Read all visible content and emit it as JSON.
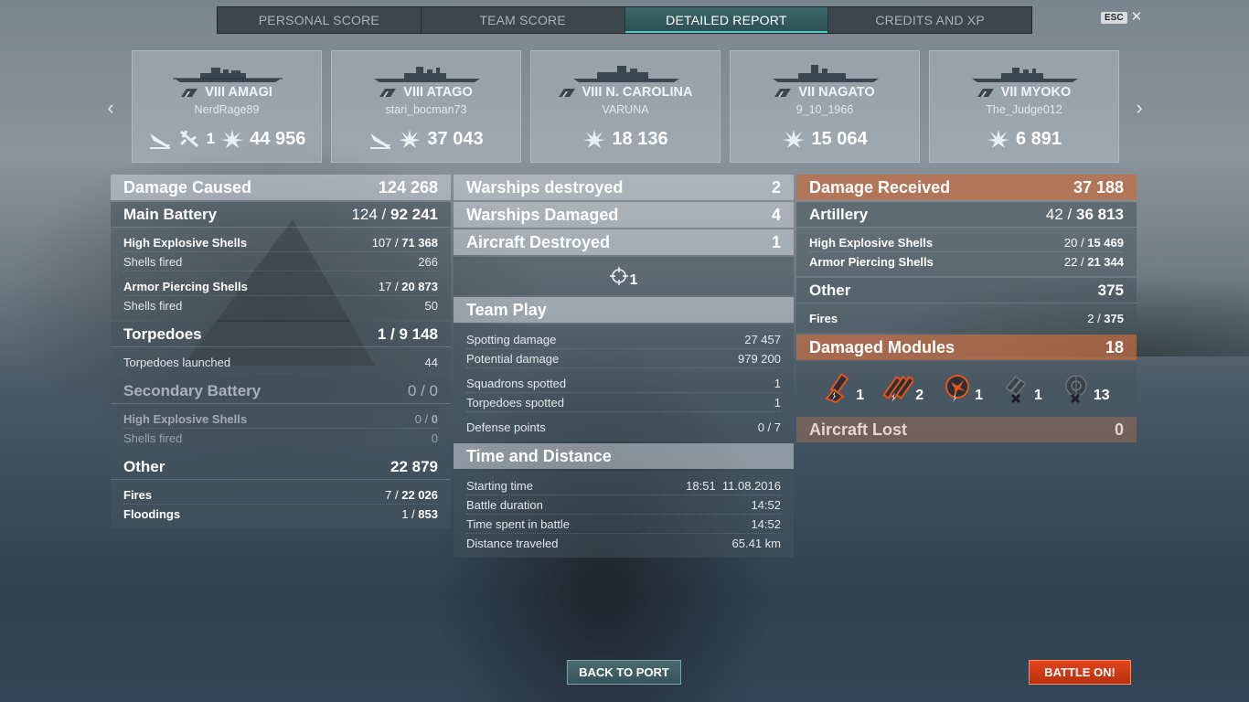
{
  "tabs": {
    "personal_score": "PERSONAL SCORE",
    "team_score": "TEAM SCORE",
    "detailed_report": "DETAILED REPORT",
    "credits_xp": "CREDITS AND XP"
  },
  "esc_label": "ESC",
  "ships": [
    {
      "tier_name": "VIII AMAGI",
      "player": "NerdRage89",
      "planes": "1",
      "damage": "44 956"
    },
    {
      "tier_name": "VIII ATAGO",
      "player": "stari_bocman73",
      "damage": "37 043"
    },
    {
      "tier_name": "VIII N. CAROLINA",
      "player": "VARUNA",
      "damage": "18 136"
    },
    {
      "tier_name": "VII NAGATO",
      "player": "9_10_1966",
      "damage": "15 064"
    },
    {
      "tier_name": "VII MYOKO",
      "player": "The_Judge012",
      "damage": "6 891"
    }
  ],
  "left": {
    "damage_caused": {
      "label": "Damage Caused",
      "value": "124 268"
    },
    "main_battery": {
      "label": "Main Battery",
      "hits": "124",
      "sep": " / ",
      "value": "92 241"
    },
    "he_shells": {
      "label": "High Explosive Shells",
      "hits": "107",
      "value": "71 368"
    },
    "he_fired": {
      "label": "Shells fired",
      "value": "266"
    },
    "ap_shells": {
      "label": "Armor Piercing Shells",
      "hits": "17",
      "value": "20 873"
    },
    "ap_fired": {
      "label": "Shells fired",
      "value": "50"
    },
    "torpedoes": {
      "label": "Torpedoes",
      "value": "1 / 9 148"
    },
    "torps_launched": {
      "label": "Torpedoes launched",
      "value": "44"
    },
    "secondary": {
      "label": "Secondary Battery",
      "value": "0 / 0"
    },
    "sec_he": {
      "label": "High Explosive Shells",
      "hits": "0",
      "value": "0"
    },
    "sec_fired": {
      "label": "Shells fired",
      "value": "0"
    },
    "other": {
      "label": "Other",
      "value": "22 879"
    },
    "fires": {
      "label": "Fires",
      "hits": "7",
      "value": "22 026"
    },
    "floodings": {
      "label": "Floodings",
      "hits": "1",
      "value": "853"
    }
  },
  "mid": {
    "warships_destroyed": {
      "label": "Warships destroyed",
      "value": "2"
    },
    "warships_damaged": {
      "label": "Warships Damaged",
      "value": "4"
    },
    "aircraft_destroyed": {
      "label": "Aircraft Destroyed",
      "value": "1"
    },
    "aircraft_icon_count": "1",
    "team_play": {
      "label": "Team Play"
    },
    "spotting_damage": {
      "label": "Spotting damage",
      "value": "27 457"
    },
    "potential_damage": {
      "label": "Potential damage",
      "value": "979 200"
    },
    "squadrons_spotted": {
      "label": "Squadrons spotted",
      "value": "1"
    },
    "torpedoes_spotted": {
      "label": "Torpedoes spotted",
      "value": "1"
    },
    "defense_points": {
      "label": "Defense points",
      "value": "0 / 7"
    },
    "time_distance": {
      "label": "Time and Distance"
    },
    "starting_time": {
      "label": "Starting time",
      "value": "18:51  11.08.2016"
    },
    "battle_duration": {
      "label": "Battle duration",
      "value": "14:52"
    },
    "time_spent": {
      "label": "Time spent in battle",
      "value": "14:52"
    },
    "distance": {
      "label": "Distance traveled",
      "value": "65.41 km"
    }
  },
  "right": {
    "damage_received": {
      "label": "Damage Received",
      "value": "37 188"
    },
    "artillery": {
      "label": "Artillery",
      "hits": "42",
      "value": "36 813"
    },
    "he_shells": {
      "label": "High Explosive Shells",
      "hits": "20",
      "value": "15 469"
    },
    "ap_shells": {
      "label": "Armor Piercing Shells",
      "hits": "22",
      "value": "21 344"
    },
    "other": {
      "label": "Other",
      "value": "375"
    },
    "fires": {
      "label": "Fires",
      "hits": "2",
      "value": "375"
    },
    "damaged_modules": {
      "label": "Damaged Modules",
      "value": "18"
    },
    "modules": [
      {
        "icon": "main-battery-module-icon",
        "count": "1"
      },
      {
        "icon": "torpedo-tubes-module-icon",
        "count": "2"
      },
      {
        "icon": "aa-module-icon",
        "count": "1"
      },
      {
        "icon": "secondary-battery-destroyed-icon",
        "count": "1"
      },
      {
        "icon": "rangefinder-destroyed-icon",
        "count": "13"
      }
    ],
    "aircraft_lost": {
      "label": "Aircraft Lost",
      "value": "0"
    }
  },
  "buttons": {
    "back_to_port": "BACK TO PORT",
    "battle_on": "BATTLE ON!"
  },
  "colors": {
    "accent_teal": "#58c7c0",
    "battle_button": "#d63a14",
    "received_header": "#c46e44"
  }
}
